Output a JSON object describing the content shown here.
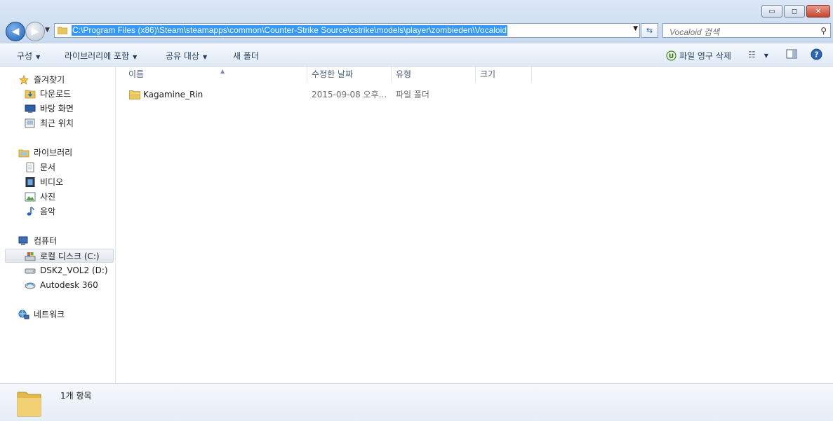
{
  "window": {
    "controls": {
      "minimize": "▭",
      "maximize": "◻",
      "close": "✕"
    }
  },
  "address_bar": {
    "path": "C:\\Program Files (x86)\\Steam\\steamapps\\common\\Counter-Strike Source\\cstrike\\models\\player\\zombieden\\Vocaloid",
    "folder_icon": "folder-icon"
  },
  "search": {
    "placeholder": "Vocaloid 검색",
    "icon": "search-icon"
  },
  "toolbar": {
    "organize": "구성",
    "include_in_library": "라이브러리에 포함",
    "share_with": "공유 대상",
    "new_folder": "새 폴더",
    "permanent_delete": "파일 영구 삭제"
  },
  "nav": {
    "favorites": {
      "header": "즐겨찾기",
      "items": [
        "다운로드",
        "바탕 화면",
        "최근 위치"
      ]
    },
    "libraries": {
      "header": "라이브러리",
      "items": [
        "문서",
        "비디오",
        "사진",
        "음악"
      ]
    },
    "computer": {
      "header": "컴퓨터",
      "items": [
        "로컬 디스크 (C:)",
        "DSK2_VOL2 (D:)",
        "Autodesk 360"
      ],
      "selected": "로컬 디스크 (C:)"
    },
    "network": {
      "header": "네트워크"
    }
  },
  "columns": [
    "이름",
    "수정한 날짜",
    "유형",
    "크기"
  ],
  "files": [
    {
      "name": "Kagamine_Rin",
      "modified": "2015-09-08 오후...",
      "type": "파일 폴더",
      "size": ""
    }
  ],
  "details": {
    "item_count": "1개 항목"
  },
  "colors": {
    "selection": "#3399ff",
    "toolbar_text": "#1e3a5e",
    "header_text": "#4c607a"
  }
}
